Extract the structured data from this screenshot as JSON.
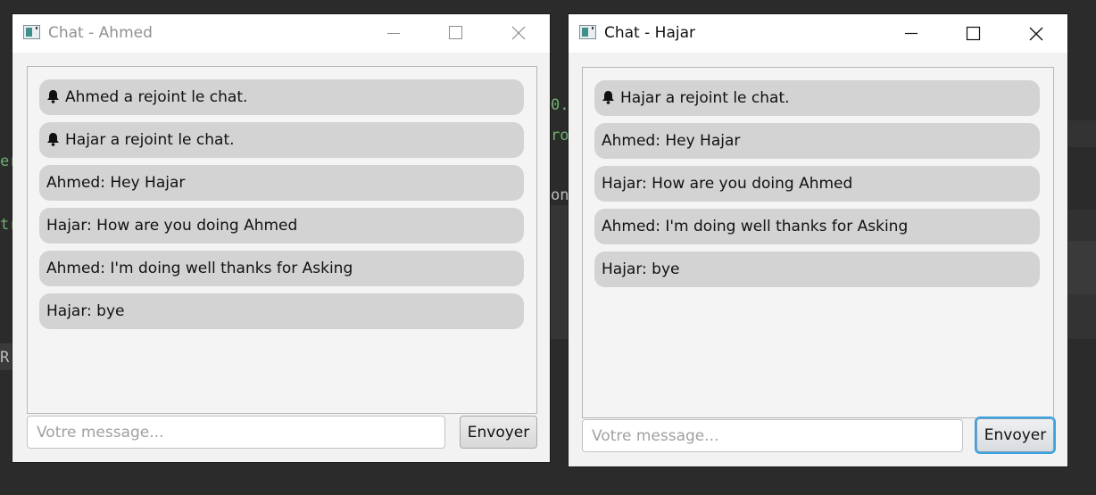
{
  "background": {
    "fragments": [
      "0.",
      "ro",
      "er",
      "on",
      "tr",
      "R"
    ]
  },
  "windows": [
    {
      "title": "Chat - Ahmed",
      "focused": false,
      "messages": [
        {
          "text": "Ahmed a rejoint le chat.",
          "system": true
        },
        {
          "text": "Hajar a rejoint le chat.",
          "system": true
        },
        {
          "text": "Ahmed: Hey Hajar",
          "system": false
        },
        {
          "text": "Hajar: How are you doing Ahmed",
          "system": false
        },
        {
          "text": "Ahmed: I'm doing well thanks for Asking",
          "system": false
        },
        {
          "text": "Hajar: bye",
          "system": false
        }
      ],
      "input": {
        "placeholder": "Votre message...",
        "value": ""
      },
      "send_label": "Envoyer"
    },
    {
      "title": "Chat - Hajar",
      "focused": true,
      "messages": [
        {
          "text": "Hajar a rejoint le chat.",
          "system": true
        },
        {
          "text": "Ahmed: Hey Hajar",
          "system": false
        },
        {
          "text": "Hajar: How are you doing Ahmed",
          "system": false
        },
        {
          "text": "Ahmed: I'm doing well thanks for Asking",
          "system": false
        },
        {
          "text": "Hajar: bye",
          "system": false
        }
      ],
      "input": {
        "placeholder": "Votre message...",
        "value": ""
      },
      "send_label": "Envoyer"
    }
  ],
  "icons": {
    "app": "java-app-icon",
    "minimize": "minimize-icon",
    "maximize": "maximize-icon",
    "close": "close-icon",
    "system_message": "bell-icon"
  },
  "colors": {
    "desktop_bg": "#2b2b2b",
    "bubble_bg": "#d3d3d3",
    "focus_ring": "#3ba4e0",
    "titlebar_bg": "#ffffff"
  }
}
